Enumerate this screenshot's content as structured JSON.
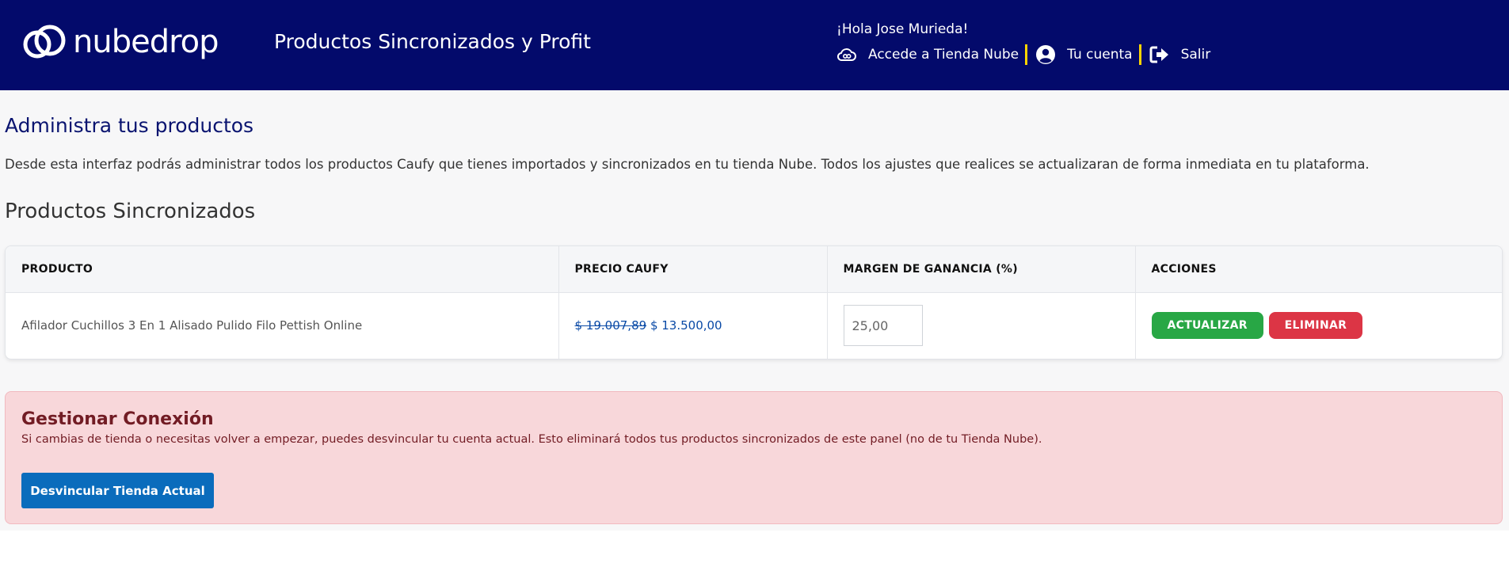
{
  "header": {
    "logo_text": "nubedrop",
    "app_title": "Productos Sincronizados y Profit",
    "greeting": "¡Hola Jose Murieda!",
    "nav": {
      "store_link": "Accede a Tienda Nube",
      "account_link": "Tu cuenta",
      "logout_link": "Salir"
    }
  },
  "intro": {
    "heading": "Administra tus productos",
    "description": "Desde esta interfaz podrás administrar todos los productos Caufy que tienes importados y sincronizados en tu tienda Nube. Todos los ajustes que realices se actualizaran de forma inmediata en tu plataforma."
  },
  "products": {
    "heading": "Productos Sincronizados",
    "columns": [
      "PRODUCTO",
      "PRECIO CAUFY",
      "MARGEN DE GANANCIA (%)",
      "ACCIONES"
    ],
    "rows": [
      {
        "name": "Afilador Cuchillos 3 En 1 Alisado Pulido Filo Pettish Online",
        "old_price": "$ 19.007,89",
        "new_price": "$ 13.500,00",
        "margin": "25,00",
        "update_label": "ACTUALIZAR",
        "delete_label": "ELIMINAR"
      }
    ]
  },
  "connection": {
    "title": "Gestionar Conexión",
    "text": "Si cambias de tienda o necesitas volver a empezar, puedes desvincular tu cuenta actual. Esto eliminará todos tus productos sincronizados de este panel (no de tu Tienda Nube).",
    "button_label": "Desvincular Tienda Actual"
  },
  "colors": {
    "header_bg": "#030a6b",
    "separator": "#ffd400",
    "update_button": "#28a745",
    "delete_button": "#dc3545",
    "unlink_button": "#0a6cbc",
    "danger_bg": "#f8d7da"
  },
  "icons": {
    "logo": "nubedrop-cloud-logo-icon",
    "store": "cloud-icon",
    "account": "user-circle-icon",
    "logout": "sign-out-icon"
  }
}
